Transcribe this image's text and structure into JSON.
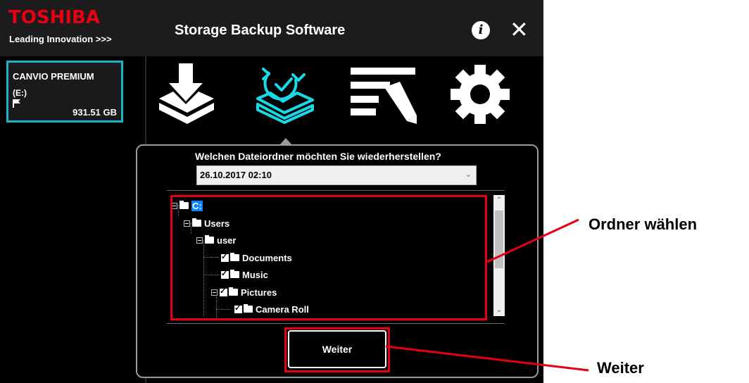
{
  "brand": {
    "logo_text": "TOSHIBA",
    "tagline": "Leading Innovation >>>",
    "logo_color": "#e60012"
  },
  "titlebar": {
    "title": "Storage Backup Software",
    "info_icon": "info-icon",
    "close_icon": "close-icon",
    "close_glyph": "✕",
    "info_glyph": "i"
  },
  "device": {
    "name": "CANVIO PREMIUM",
    "drive_letter": "(E:)",
    "capacity": "931.51 GB",
    "accent_color": "#17b3c7"
  },
  "nav": {
    "items": [
      {
        "icon": "backup-icon",
        "active": false
      },
      {
        "icon": "restore-icon",
        "active": true
      },
      {
        "icon": "log-edit-icon",
        "active": false
      },
      {
        "icon": "gear-icon",
        "active": false
      }
    ]
  },
  "restore": {
    "question": "Welchen Dateiordner möchten Sie wiederherstellen?",
    "selected_date": "26.10.2017 02:10",
    "tree": [
      {
        "label": "C:",
        "checked": null,
        "selected": true
      },
      {
        "label": "Users",
        "checked": null
      },
      {
        "label": "user",
        "checked": null
      },
      {
        "label": "Documents",
        "checked": true
      },
      {
        "label": "Music",
        "checked": true
      },
      {
        "label": "Pictures",
        "checked": true
      },
      {
        "label": "Camera Roll",
        "checked": true
      }
    ],
    "next_button": "Weiter"
  },
  "annotations": {
    "folder_callout": "Ordner wählen",
    "next_callout": "Weiter",
    "highlight_color": "#e60012"
  }
}
